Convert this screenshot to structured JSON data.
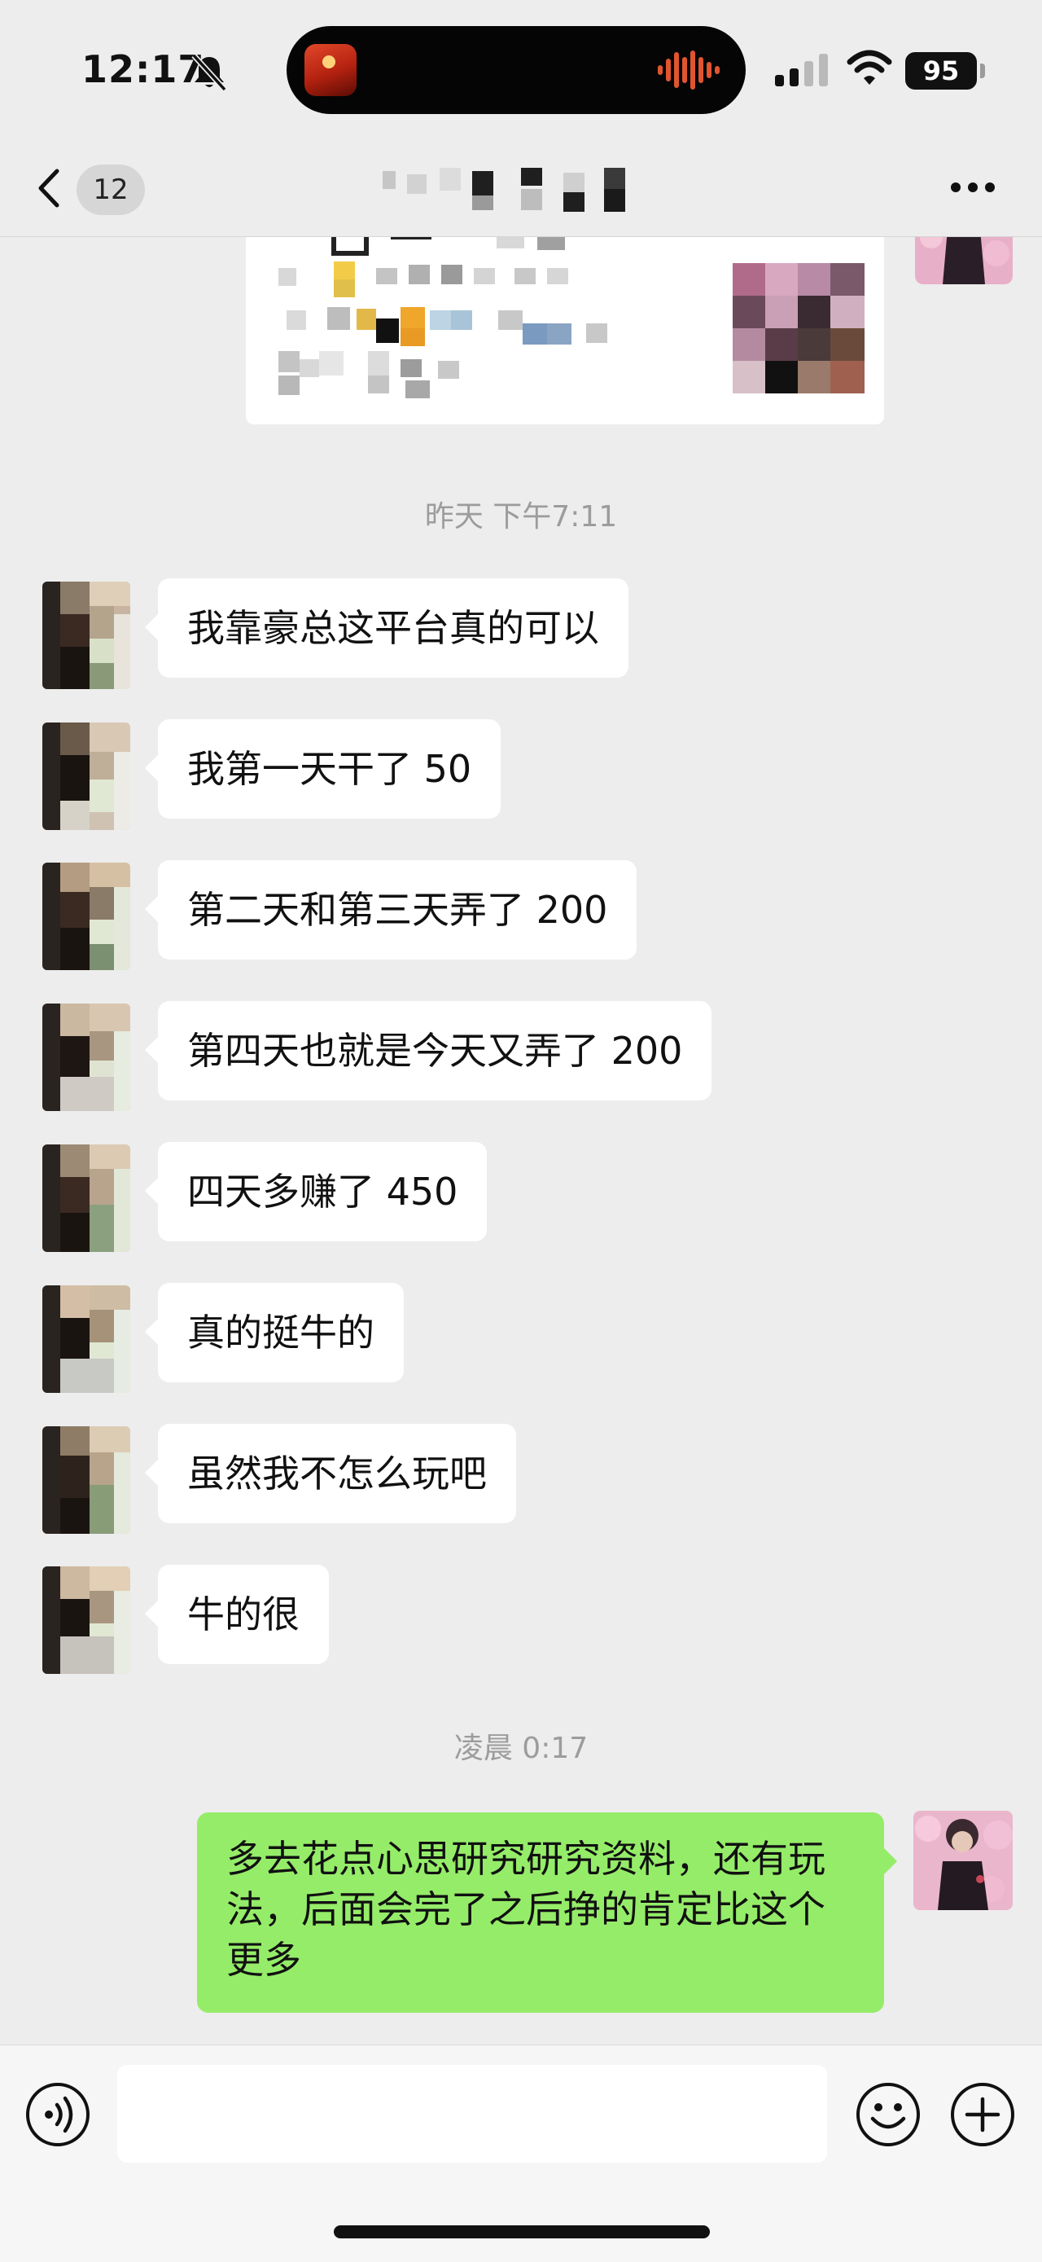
{
  "status_bar": {
    "time": "12:17",
    "battery": "95"
  },
  "nav": {
    "back_count": "12",
    "title": ""
  },
  "messages": {
    "timestamp_1": "昨天 下午7:11",
    "incoming": [
      "我靠豪总这平台真的可以",
      "我第一天干了 50",
      "第二天和第三天弄了 200",
      "第四天也就是今天又弄了 200",
      "四天多赚了 450",
      "真的挺牛的",
      "虽然我不怎么玩吧",
      "牛的很"
    ],
    "timestamp_2": "凌晨 0:17",
    "outgoing": "多去花点心思研究研究资料，还有玩法，后面会完了之后挣的肯定比这个更多"
  },
  "input": {
    "placeholder": ""
  },
  "icons": {
    "back": "chevron-left-icon",
    "more": "more-dots-icon",
    "voice": "voice-icon",
    "emoji": "emoji-icon",
    "plus": "plus-icon",
    "mute": "bell-slash-icon",
    "signal": "signal-icon",
    "wifi": "wifi-icon"
  },
  "colors": {
    "background": "#ededed",
    "incoming_bubble": "#ffffff",
    "outgoing_bubble": "#95ec69",
    "timestamp": "#9c9c9c"
  }
}
